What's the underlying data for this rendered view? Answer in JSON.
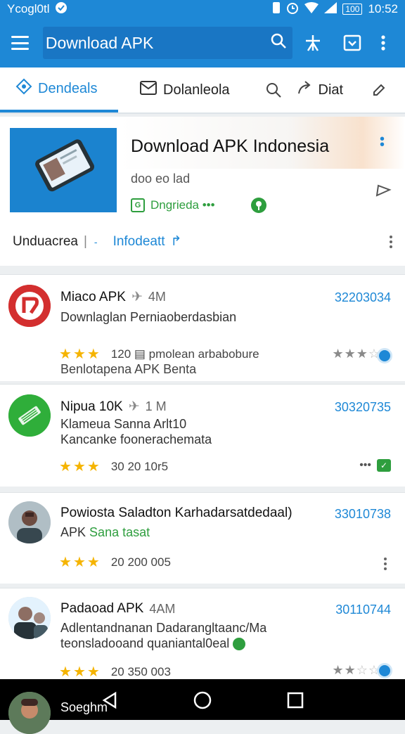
{
  "status": {
    "carrier": "Ycogl0tl",
    "time": "10:52",
    "battery": "100"
  },
  "appbar": {
    "search_text": "Download APK"
  },
  "tabs": [
    {
      "label": "Dendeals"
    },
    {
      "label": "Dolanleola"
    },
    {
      "label": "Diat"
    }
  ],
  "hero": {
    "title": "Download APK Indonesia",
    "subtitle": "doo eo lad",
    "tag": "Dngrieda •••",
    "row_left": "Unduacrea",
    "row_sep": "|",
    "row_link": "Infodeatt"
  },
  "apps": [
    {
      "title": "Miaco APK",
      "meta": "4M",
      "number": "32203034",
      "line1": "Downlaglan Perniaoberdasbian",
      "line2": "Benlotapena APK Benta",
      "stars_text": "120 ▤ pmolean arbabobure",
      "right_rating": "3"
    },
    {
      "title": "Nipua 10K",
      "meta": "1 M",
      "number": "30320735",
      "line1": "Klameua Sanna Arlt10",
      "line2": "Kancanke foonerachemata",
      "stars_text": "30 20 10r5",
      "right_rating": ""
    },
    {
      "title": "Powiosta Saladton Karhadarsatdedaal)",
      "meta": "",
      "number": "33010738",
      "line1": "APK",
      "line1_green": "Sana tasat",
      "line2": "",
      "stars_text": "20 200 005",
      "right_rating": ""
    },
    {
      "title": "Padaoad APK",
      "meta": "4AM",
      "number": "30110744",
      "line1": "Adlentandnanan Dadarangltaanc/Ma",
      "line2": "teonsladooand quaniantal0eal",
      "stars_text": "20 350 003",
      "right_rating": "2"
    }
  ],
  "bottom_peek": {
    "name": "Soeghm"
  },
  "colors": {
    "primary": "#1e88d6",
    "star": "#f5b400",
    "green": "#2e9e3e"
  }
}
